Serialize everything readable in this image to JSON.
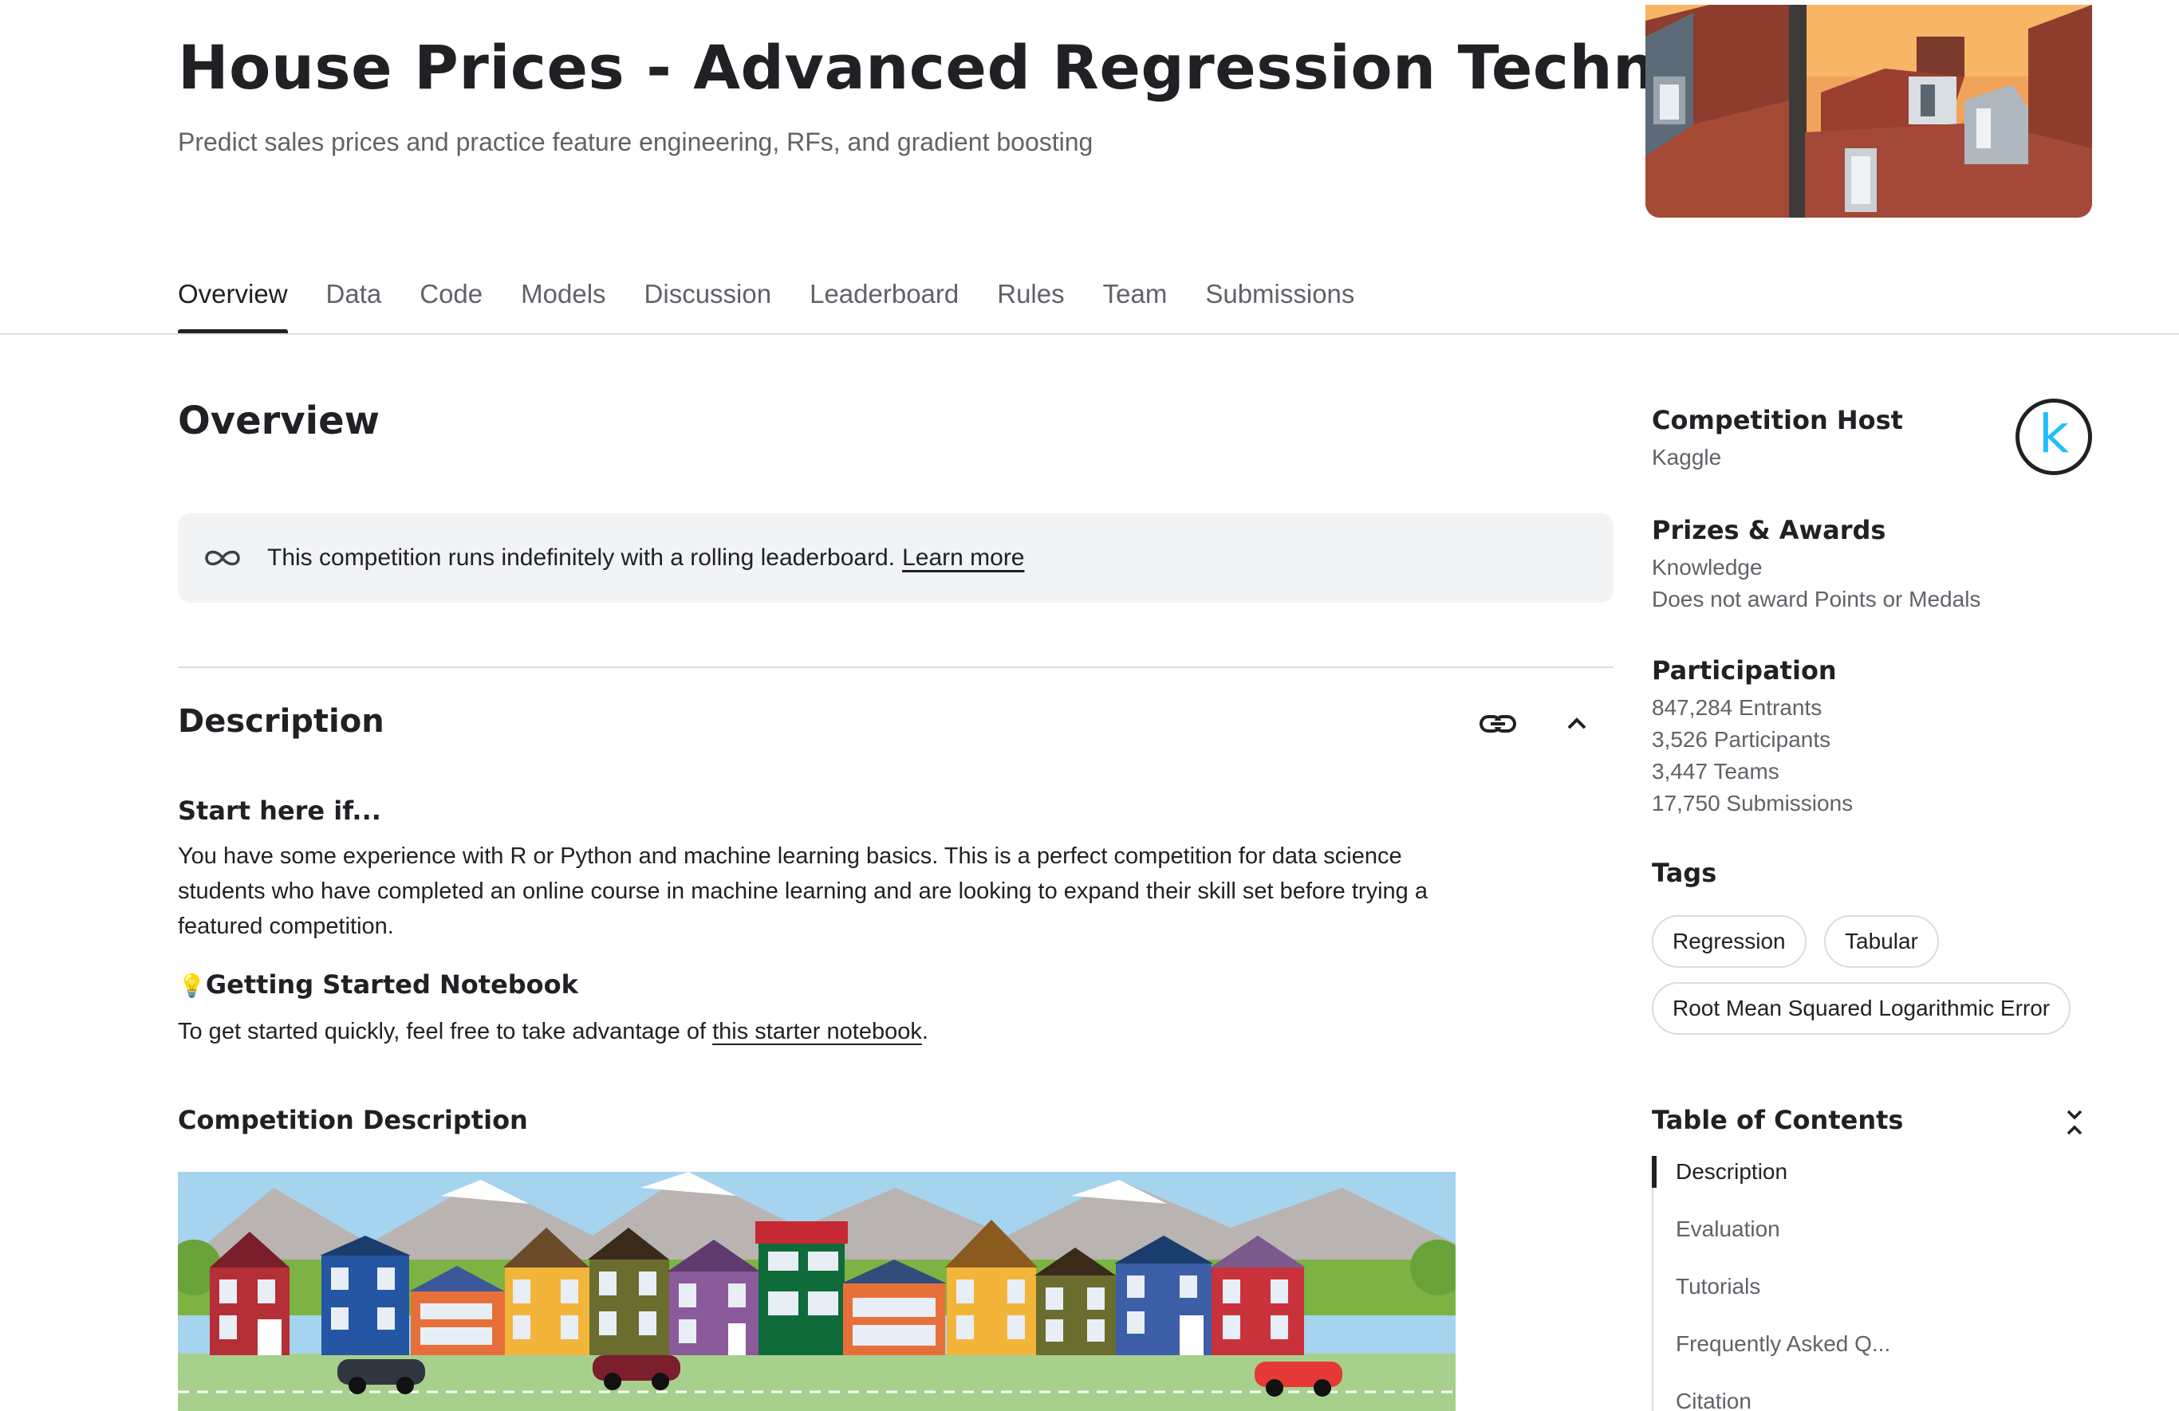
{
  "header": {
    "title": "House Prices - Advanced Regression Techniques",
    "subtitle": "Predict sales prices and practice feature engineering, RFs, and gradient boosting"
  },
  "tabs": [
    {
      "label": "Overview",
      "active": true
    },
    {
      "label": "Data"
    },
    {
      "label": "Code"
    },
    {
      "label": "Models"
    },
    {
      "label": "Discussion"
    },
    {
      "label": "Leaderboard"
    },
    {
      "label": "Rules"
    },
    {
      "label": "Team"
    },
    {
      "label": "Submissions"
    }
  ],
  "main": {
    "section_title": "Overview",
    "banner": {
      "icon": "infinity-icon",
      "text": "This competition runs indefinitely with a rolling leaderboard.",
      "link": "Learn more"
    },
    "description": {
      "title": "Description",
      "start_heading": "Start here if...",
      "start_text": "You have some experience with R or Python and machine learning basics. This is a perfect competition for data science students who have completed an online course in machine learning and are looking to expand their skill set before trying a featured competition.",
      "notebook_emoji": "💡",
      "notebook_heading": "Getting Started Notebook",
      "notebook_text_before": "To get started quickly, feel free to take advantage of",
      "notebook_link": "this starter notebook",
      "notebook_text_after": ".",
      "competition_heading": "Competition Description"
    }
  },
  "sidebar": {
    "host": {
      "heading": "Competition Host",
      "name": "Kaggle",
      "logo_letter": "k"
    },
    "prizes": {
      "heading": "Prizes & Awards",
      "line1": "Knowledge",
      "line2": "Does not award Points or Medals"
    },
    "participation": {
      "heading": "Participation",
      "entrants": "847,284 Entrants",
      "participants": "3,526 Participants",
      "teams": "3,447 Teams",
      "submissions": "17,750 Submissions"
    },
    "tags": {
      "heading": "Tags",
      "items": [
        "Regression",
        "Tabular",
        "Root Mean Squared Logarithmic Error"
      ]
    },
    "toc": {
      "heading": "Table of Contents",
      "items": [
        "Description",
        "Evaluation",
        "Tutorials",
        "Frequently Asked Q...",
        "Citation"
      ]
    }
  },
  "colors": {
    "accent": "#20beff",
    "text": "#202124",
    "muted": "#5f6368",
    "banner_bg": "#f1f3f4"
  }
}
